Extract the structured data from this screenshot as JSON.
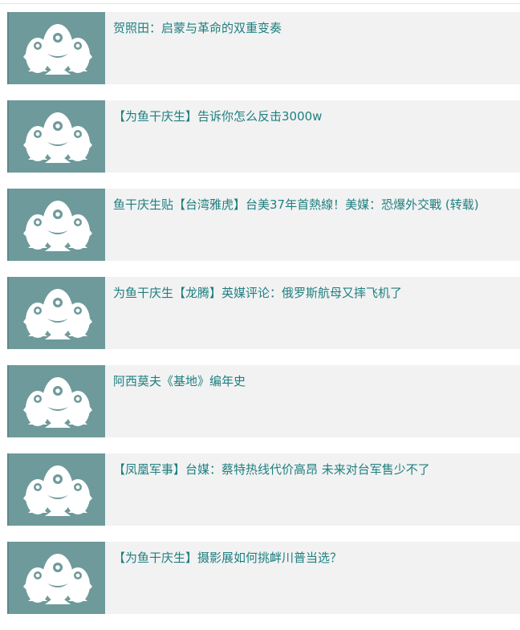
{
  "colors": {
    "thumb_bg": "#6e9a9b",
    "card_bg": "#f2f2f2",
    "link_text": "#1f7f80"
  },
  "list": {
    "items": [
      {
        "title": "贺照田：启蒙与革命的双重变奏",
        "icon": "fish-group-icon"
      },
      {
        "title": "【为鱼干庆生】告诉你怎么反击3000w",
        "icon": "fish-group-icon"
      },
      {
        "title": "鱼干庆生贴【台湾雅虎】台美37年首熱線！美媒：恐爆外交戰 (转载)",
        "icon": "fish-group-icon"
      },
      {
        "title": "为鱼干庆生【龙腾】英媒评论：俄罗斯航母又摔飞机了",
        "icon": "fish-group-icon"
      },
      {
        "title": "阿西莫夫《基地》编年史",
        "icon": "fish-group-icon"
      },
      {
        "title": "【凤凰军事】台媒：蔡特热线代价高昂 未来对台军售少不了",
        "icon": "fish-group-icon"
      },
      {
        "title": "【为鱼干庆生】摄影展如何挑衅川普当选？",
        "icon": "fish-group-icon"
      }
    ]
  }
}
